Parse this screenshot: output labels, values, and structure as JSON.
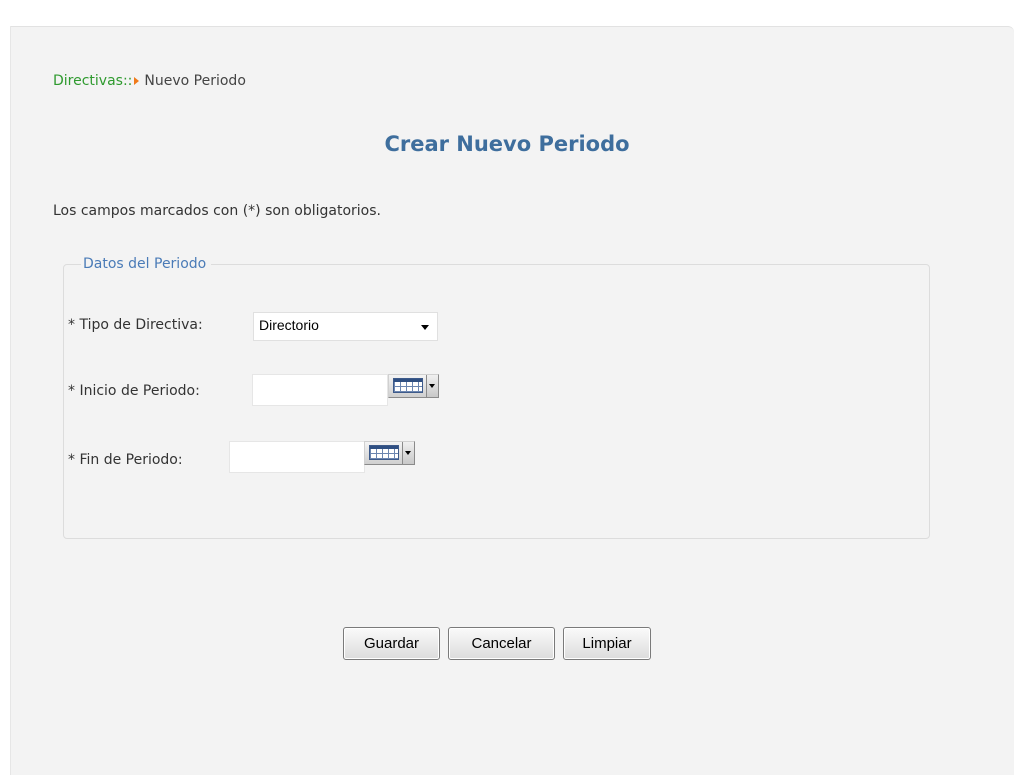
{
  "breadcrumb": {
    "root": "Directivas::",
    "current": "Nuevo Periodo"
  },
  "page": {
    "title": "Crear Nuevo Periodo",
    "required_note": "Los campos marcados con (*) son obligatorios."
  },
  "form": {
    "legend": "Datos del Periodo",
    "tipo_label": "* Tipo de Directiva:",
    "tipo_value": "Directorio",
    "inicio_label": "* Inicio de Periodo:",
    "inicio_value": "",
    "fin_label": "* Fin de Periodo:",
    "fin_value": ""
  },
  "actions": {
    "guardar": "Guardar",
    "cancelar": "Cancelar",
    "limpiar": "Limpiar"
  },
  "icons": {
    "breadcrumb_separator": "orange-right-triangle",
    "calendar": "calendar-picker-icon",
    "dropdown": "chevron-down-icon"
  },
  "colors": {
    "breadcrumb_root": "#2e9a2e",
    "breadcrumb_separator": "#f07a1a",
    "title": "#3e6e9d",
    "legend": "#4a7bb7",
    "panel_background": "#f3f3f3"
  }
}
